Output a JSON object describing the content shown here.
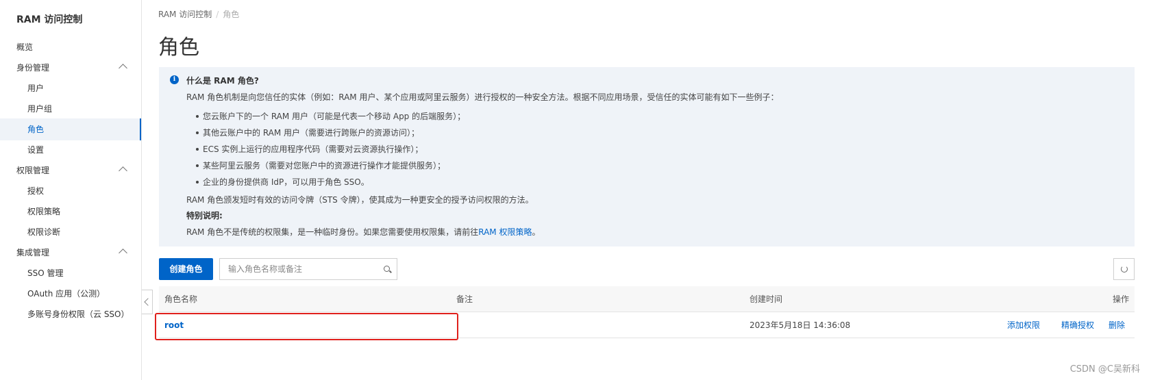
{
  "sidebar": {
    "title": "RAM 访问控制",
    "items": [
      {
        "label": "概览"
      },
      {
        "label": "身份管理"
      },
      {
        "label": "用户"
      },
      {
        "label": "用户组"
      },
      {
        "label": "角色"
      },
      {
        "label": "设置"
      },
      {
        "label": "权限管理"
      },
      {
        "label": "授权"
      },
      {
        "label": "权限策略"
      },
      {
        "label": "权限诊断"
      },
      {
        "label": "集成管理"
      },
      {
        "label": "SSO 管理"
      },
      {
        "label": "OAuth 应用（公测）"
      },
      {
        "label": "多账号身份权限（云 SSO）"
      }
    ]
  },
  "breadcrumb": {
    "root": "RAM 访问控制",
    "separator": "/",
    "current": "角色"
  },
  "page_title": "角色",
  "info": {
    "title": "什么是 RAM 角色?",
    "intro": "RAM 角色机制是向您信任的实体（例如：RAM 用户、某个应用或阿里云服务）进行授权的一种安全方法。根据不同应用场景，受信任的实体可能有如下一些例子：",
    "list": [
      "您云账户下的一个 RAM 用户（可能是代表一个移动 App 的后端服务）；",
      "其他云账户中的 RAM 用户（需要进行跨账户的资源访问）；",
      "ECS 实例上运行的应用程序代码（需要对云资源执行操作）；",
      "某些阿里云服务（需要对您账户中的资源进行操作才能提供服务）；",
      "企业的身份提供商 IdP，可以用于角色 SSO。"
    ],
    "sts_text": "RAM 角色颁发短时有效的访问令牌（STS 令牌），使其成为一种更安全的授予访问权限的方法。",
    "special_label": "特别说明:",
    "special_text": "RAM 角色不是传统的权限集，是一种临时身份。如果您需要使用权限集，请前往",
    "special_link": "RAM 权限策略",
    "special_end": "。"
  },
  "toolbar": {
    "create_label": "创建角色",
    "search_placeholder": "输入角色名称或备注"
  },
  "table": {
    "columns": [
      "角色名称",
      "备注",
      "创建时间",
      "操作"
    ],
    "rows": [
      {
        "name": "root",
        "note": "",
        "created": "2023年5月18日 14:36:08",
        "actions": [
          "添加权限",
          "精确授权",
          "删除"
        ]
      }
    ]
  },
  "watermark": "CSDN @C吴新科",
  "colors": {
    "accent": "#0064c8",
    "highlight": "#e0201c",
    "info_bg": "#eff3f8"
  },
  "icons": [
    "info-icon",
    "chevron-up-icon",
    "search-icon",
    "refresh-icon",
    "chevron-left-icon"
  ]
}
